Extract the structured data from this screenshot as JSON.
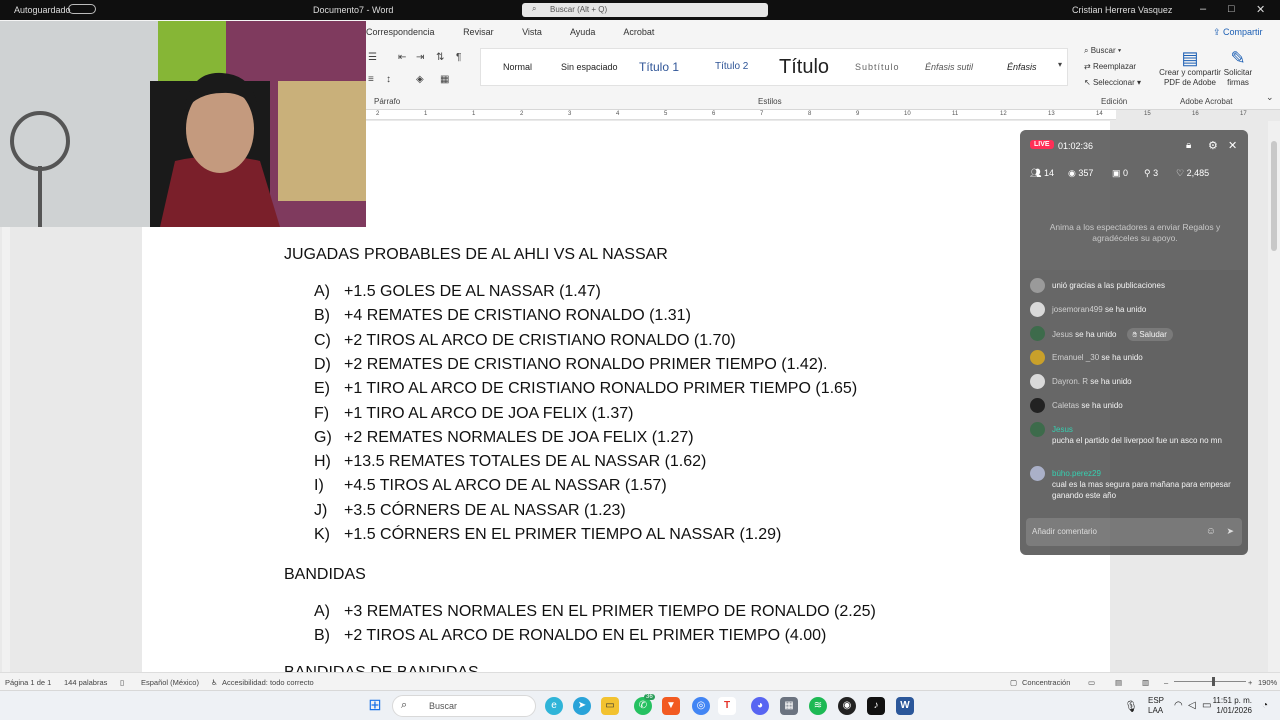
{
  "window": {
    "autosave_label": "Autoguardado",
    "doc_title": "Documento7 - Word",
    "search_placeholder": "Buscar (Alt + Q)",
    "user_name": "Cristian Herrera Vasquez"
  },
  "ribbon": {
    "tabs": [
      "Correspondencia",
      "Revisar",
      "Vista",
      "Ayuda",
      "Acrobat"
    ],
    "share_label": "Compartir",
    "paragraph_group_label": "Párrafo",
    "styles_group_label": "Estilos",
    "editing_group_label": "Edición",
    "acrobat_group_label": "Adobe Acrobat",
    "styles": [
      "Normal",
      "Sin espaciado",
      "Título 1",
      "Título 2",
      "Título",
      "Subtítulo",
      "Énfasis sutil",
      "Énfasis"
    ],
    "editing": {
      "find": "Buscar",
      "replace": "Reemplazar",
      "select": "Seleccionar"
    },
    "acrobat": {
      "create_pdf_line1": "Crear y compartir",
      "create_pdf_line2": "PDF de Adobe",
      "sign_line1": "Solicitar",
      "sign_line2": "firmas"
    }
  },
  "ruler_numbers": [
    "2",
    "1",
    "1",
    "2",
    "3",
    "4",
    "5",
    "6",
    "7",
    "8",
    "9",
    "10",
    "11",
    "12",
    "13",
    "14",
    "15",
    "16",
    "17"
  ],
  "document": {
    "heading1": "JUGADAS PROBABLES DE AL AHLI VS AL NASSAR",
    "list1": [
      {
        "letter": "A)",
        "text": "+1.5 GOLES DE AL NASSAR (1.47)"
      },
      {
        "letter": "B)",
        "text": "+4 REMATES DE CRISTIANO RONALDO (1.31)"
      },
      {
        "letter": "C)",
        "text": "+2 TIROS AL ARCO DE CRISTIANO RONALDO (1.70)"
      },
      {
        "letter": "D)",
        "text": "+2 REMATES DE CRISTIANO RONALDO PRIMER TIEMPO (1.42)."
      },
      {
        "letter": "E)",
        "text": "+1 TIRO AL ARCO DE CRISTIANO RONALDO PRIMER TIEMPO (1.65)"
      },
      {
        "letter": "F)",
        "text": "+1 TIRO AL ARCO DE JOA FELIX (1.37)"
      },
      {
        "letter": "G)",
        "text": "+2 REMATES NORMALES DE JOA FELIX (1.27)"
      },
      {
        "letter": "H)",
        "text": "+13.5 REMATES TOTALES DE AL NASSAR (1.62)"
      },
      {
        "letter": "I)",
        "text": "+4.5 TIROS AL ARCO DE AL NASSAR (1.57)"
      },
      {
        "letter": "J)",
        "text": "+3.5 CÓRNERS DE AL NASSAR (1.23)"
      },
      {
        "letter": "K)",
        "text": "+1.5 CÓRNERS EN EL PRIMER TIEMPO AL NASSAR (1.29)"
      }
    ],
    "heading2": "BANDIDAS",
    "list2": [
      {
        "letter": "A)",
        "text": "+3 REMATES NORMALES EN EL PRIMER TIEMPO DE RONALDO (2.25)"
      },
      {
        "letter": "B)",
        "text": "+2 TIROS AL ARCO DE RONALDO EN EL PRIMER TIEMPO (4.00)"
      }
    ],
    "heading3": "BANDIDAS DE BANDIDAS"
  },
  "live": {
    "badge": "LIVE",
    "timer": "01:02:36",
    "stats": {
      "members": "14",
      "views": "357",
      "gifts": "0",
      "shares": "3",
      "likes": "2,485"
    },
    "gift_prompt": "Anima a los espectadores a enviar Regalos y agradéceles su apoyo.",
    "chat": [
      {
        "user": "",
        "message": "unió gracias a las publicaciones",
        "avatar_color": "#9a9a9a"
      },
      {
        "user": "josemoran499",
        "message": "se ha unido",
        "avatar_color": "#d9d9d9"
      },
      {
        "user": "Jesus",
        "message": "se ha unido",
        "action": "Saludar",
        "avatar_color": "#3d6b4b"
      },
      {
        "user": "Emanuel _30",
        "message": "se ha unido",
        "avatar_color": "#c9a02a"
      },
      {
        "user": "Dayron. R",
        "message": "se ha unido",
        "avatar_color": "#d9d9d9"
      },
      {
        "user": "Caletas",
        "message": "se ha unido",
        "avatar_color": "#222222"
      },
      {
        "user": "Jesus",
        "message": "pucha el partido del liverpool fue un asco no mn",
        "avatar_color": "#3d6b4b"
      },
      {
        "user": "búho.perez29",
        "message": "cual es la mas segura para mañana para empesar ganando este año",
        "avatar_color": "#aab0c8"
      }
    ],
    "comment_placeholder": "Añadir comentario"
  },
  "status": {
    "page": "Página 1 de 1",
    "words": "144 palabras",
    "language": "Español (México)",
    "accessibility": "Accesibilidad: todo correcto",
    "focus": "Concentración",
    "zoom": "190%"
  },
  "taskbar": {
    "search_placeholder": "Buscar",
    "badge_count": "36",
    "lang_line1": "ESP",
    "lang_line2": "LAA",
    "time": "11:51 p. m.",
    "date": "1/01/2026"
  }
}
